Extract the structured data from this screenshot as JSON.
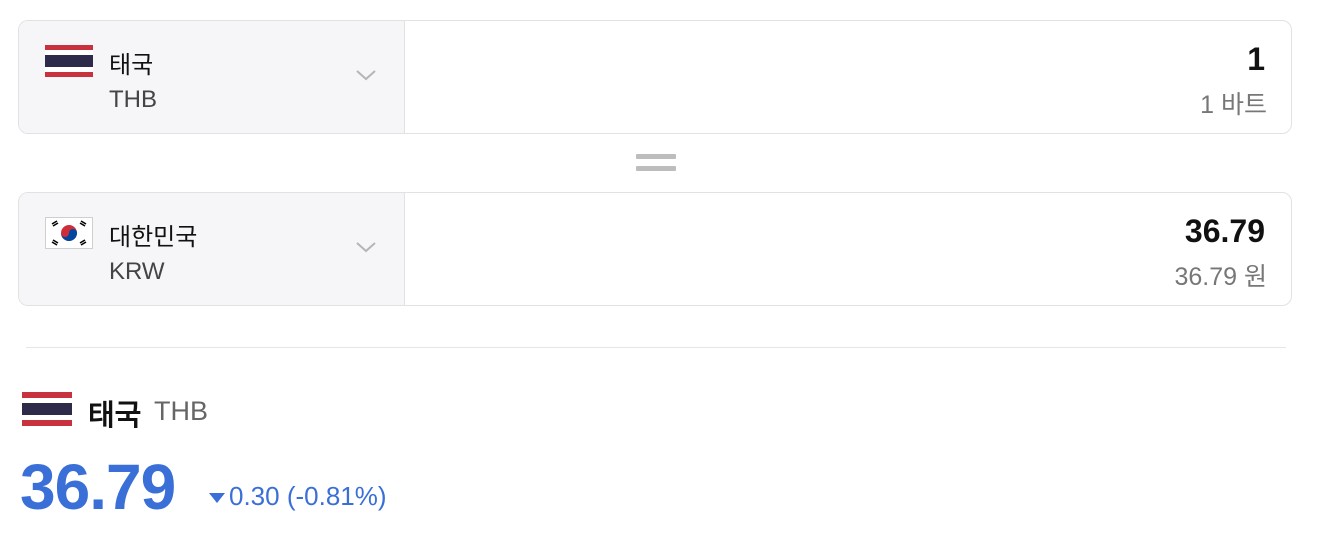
{
  "from": {
    "country": "태국",
    "code": "THB",
    "amount": "1",
    "amount_text": "1 바트",
    "flag": "thailand-flag-icon"
  },
  "to": {
    "country": "대한민국",
    "code": "KRW",
    "amount": "36.79",
    "amount_text": "36.79 원",
    "flag": "south-korea-flag-icon"
  },
  "equals_icon": "equals-icon",
  "chevron_icon": "chevron-down-icon",
  "rate": {
    "country": "태국",
    "code": "THB",
    "value": "36.79",
    "change": "0.30 (-0.81%)",
    "direction": "down",
    "color": "#3a6fd8"
  }
}
